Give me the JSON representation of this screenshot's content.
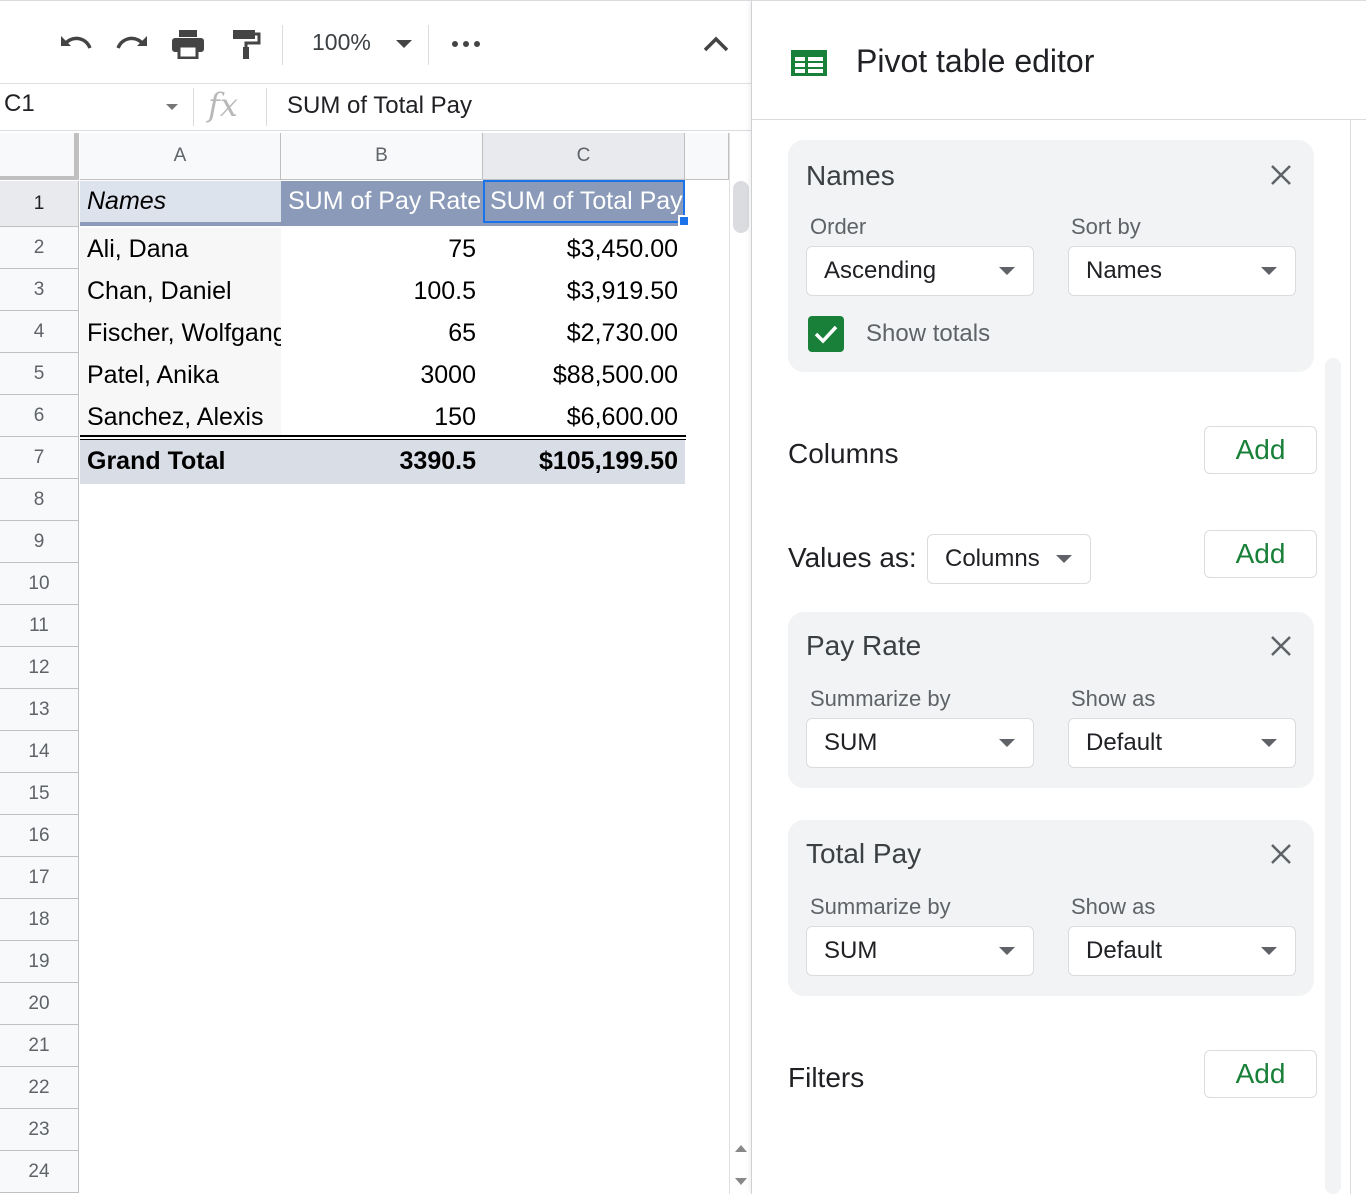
{
  "toolbar": {
    "zoom": "100%",
    "icons": [
      "undo-icon",
      "redo-icon",
      "print-icon",
      "paint-format-icon",
      "more-icon",
      "collapse-icon"
    ]
  },
  "formula_bar": {
    "name_box": "C1",
    "fx": "fx",
    "formula": "SUM of Total Pay"
  },
  "grid": {
    "columns": [
      "A",
      "B",
      "C"
    ],
    "rows": [
      "1",
      "2",
      "3",
      "4",
      "5",
      "6",
      "7",
      "8",
      "9",
      "10",
      "11",
      "12",
      "13",
      "14",
      "15",
      "16",
      "17",
      "18",
      "19",
      "20",
      "21",
      "22",
      "23",
      "24"
    ],
    "header": {
      "names": "Names",
      "pay_rate": "SUM of Pay Rate",
      "total_pay": "SUM of Total Pay"
    },
    "data": [
      {
        "name": "Ali, Dana",
        "pay_rate": "75",
        "total_pay": "$3,450.00"
      },
      {
        "name": "Chan, Daniel",
        "pay_rate": "100.5",
        "total_pay": "$3,919.50"
      },
      {
        "name": "Fischer, Wolfgang",
        "pay_rate": "65",
        "total_pay": "$2,730.00"
      },
      {
        "name": "Patel, Anika",
        "pay_rate": "3000",
        "total_pay": "$88,500.00"
      },
      {
        "name": "Sanchez, Alexis",
        "pay_rate": "150",
        "total_pay": "$6,600.00"
      }
    ],
    "total": {
      "label": "Grand Total",
      "pay_rate": "3390.5",
      "total_pay": "$105,199.50"
    }
  },
  "panel": {
    "title": "Pivot table editor",
    "rows_card": {
      "title": "Names",
      "order_label": "Order",
      "order_value": "Ascending",
      "sortby_label": "Sort by",
      "sortby_value": "Names",
      "show_totals": "Show totals",
      "show_totals_checked": true
    },
    "columns": {
      "label": "Columns",
      "add": "Add"
    },
    "values_as": {
      "label": "Values as:",
      "value": "Columns",
      "add": "Add"
    },
    "value_cards": [
      {
        "title": "Pay Rate",
        "summarize_label": "Summarize by",
        "summarize_value": "SUM",
        "show_label": "Show as",
        "show_value": "Default"
      },
      {
        "title": "Total Pay",
        "summarize_label": "Summarize by",
        "summarize_value": "SUM",
        "show_label": "Show as",
        "show_value": "Default"
      }
    ],
    "filters": {
      "label": "Filters",
      "add": "Add"
    }
  },
  "colors": {
    "header_fill": "#8a9ab8",
    "names_header_fill": "#dde3ed",
    "total_fill": "#d9dde6",
    "selection": "#1a73e8",
    "accent_green": "#188038"
  }
}
